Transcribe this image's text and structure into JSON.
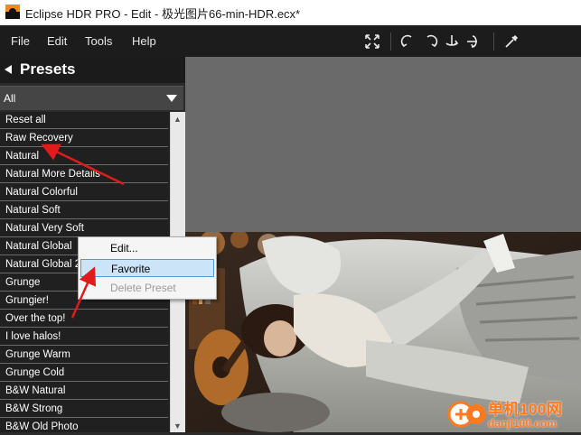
{
  "window": {
    "title": "Eclipse HDR PRO - Edit - 极光图片66-min-HDR.ecx*"
  },
  "menu": {
    "items": [
      "File",
      "Edit",
      "Tools",
      "Help"
    ]
  },
  "toolbar": {
    "icons": [
      "fit-screen-icon",
      "rotate-left-icon",
      "rotate-right-icon",
      "flip-vertical-icon",
      "flip-horizontal-icon",
      "eyedropper-icon"
    ]
  },
  "presets_panel": {
    "title": "Presets",
    "filter_selected": "All",
    "items": [
      "Reset all",
      "Raw Recovery",
      "Natural",
      "Natural More Details",
      "Natural Colorful",
      "Natural Soft",
      "Natural Very Soft",
      "Natural Global",
      "Natural Global 2",
      "Grunge",
      "Grungier!",
      "Over the top!",
      "I love halos!",
      "Grunge Warm",
      "Grunge Cold",
      "B&W Natural",
      "B&W Strong",
      "B&W Old Photo"
    ]
  },
  "context_menu": {
    "edit": "Edit...",
    "favorite": "Favorite",
    "delete": "Delete Preset"
  },
  "watermark": {
    "line1": "单机100网",
    "line2": "danji100.com"
  },
  "colors": {
    "menubar_bg": "#1c1c1c",
    "list_bg": "#202020",
    "annotation_arrow": "#e01b1b",
    "highlight": "#cce4f7"
  }
}
